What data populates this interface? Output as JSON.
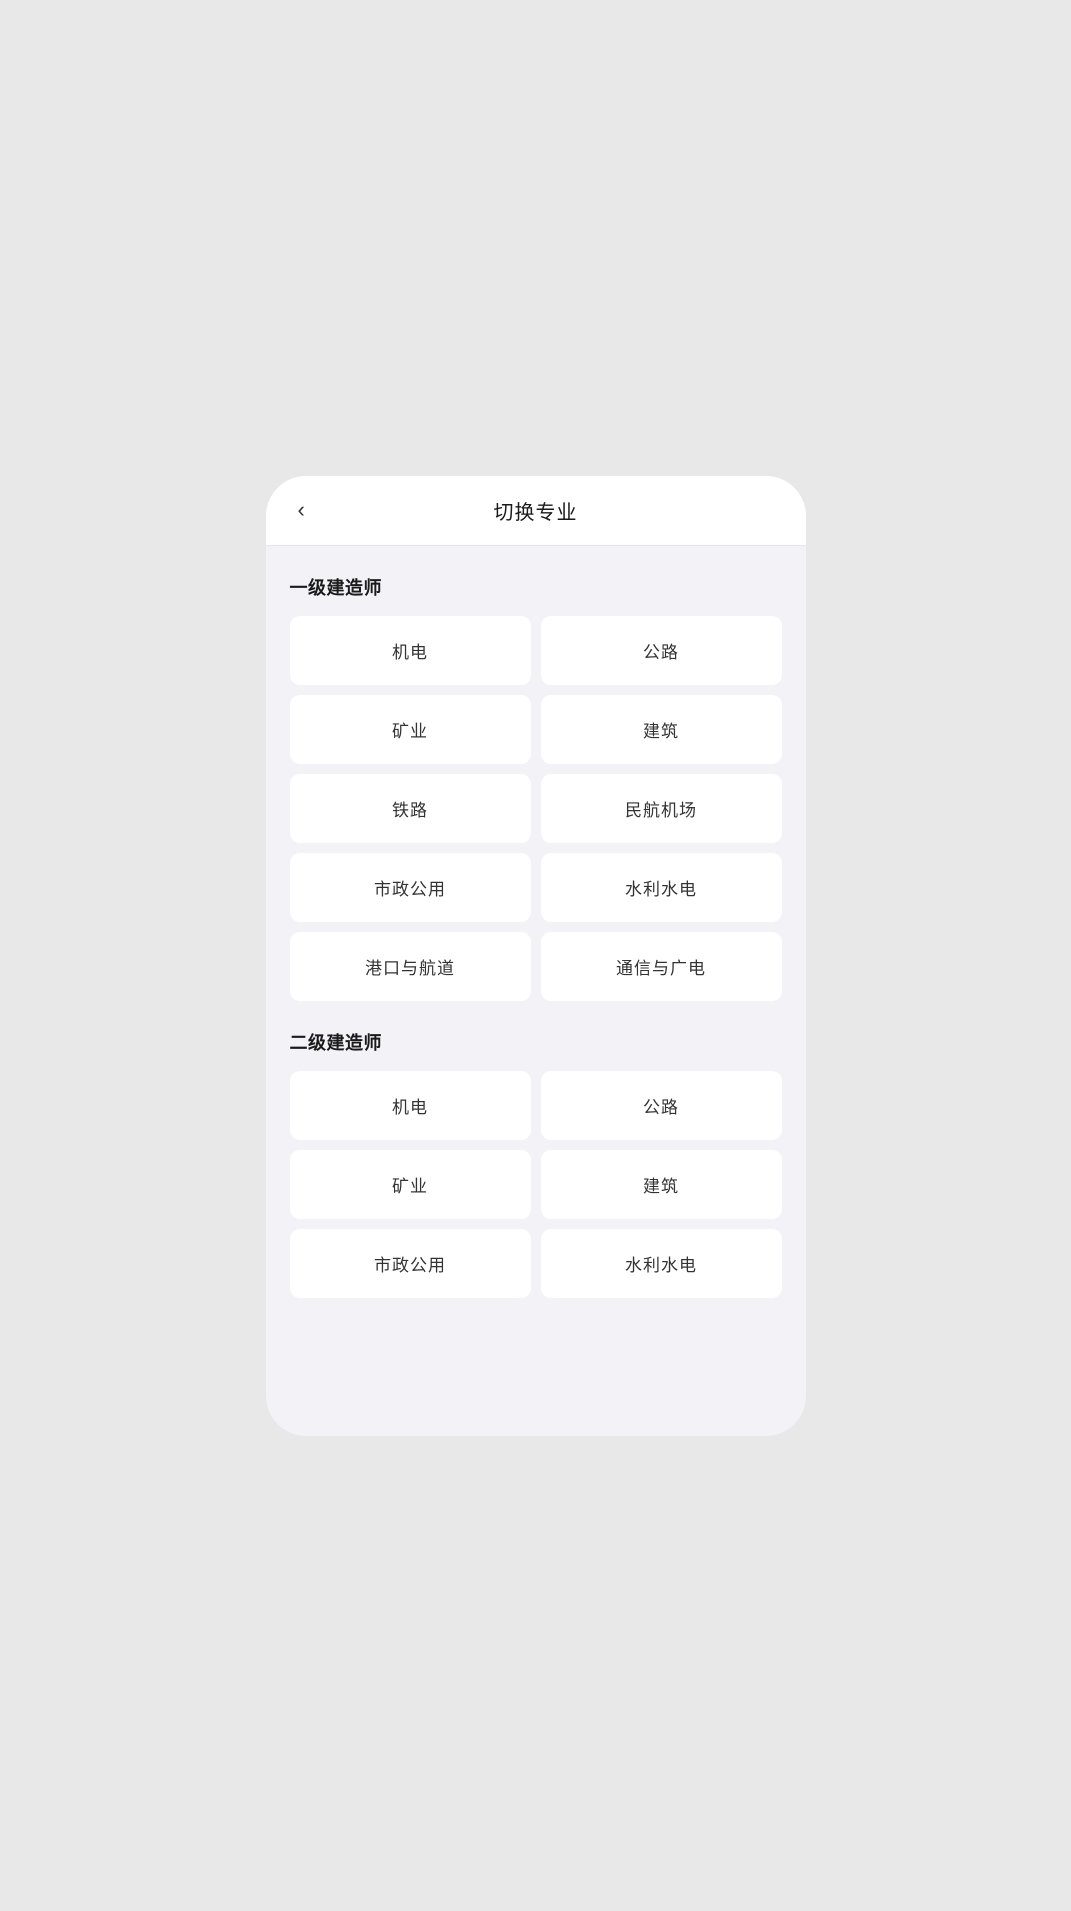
{
  "header": {
    "title": "切换专业",
    "back_label": "‹"
  },
  "sections": [
    {
      "id": "level1",
      "title": "一级建造师",
      "items": [
        "机电",
        "公路",
        "矿业",
        "建筑",
        "铁路",
        "民航机场",
        "市政公用",
        "水利水电",
        "港口与航道",
        "通信与广电"
      ]
    },
    {
      "id": "level2",
      "title": "二级建造师",
      "items": [
        "机电",
        "公路",
        "矿业",
        "建筑",
        "市政公用",
        "水利水电"
      ]
    }
  ]
}
